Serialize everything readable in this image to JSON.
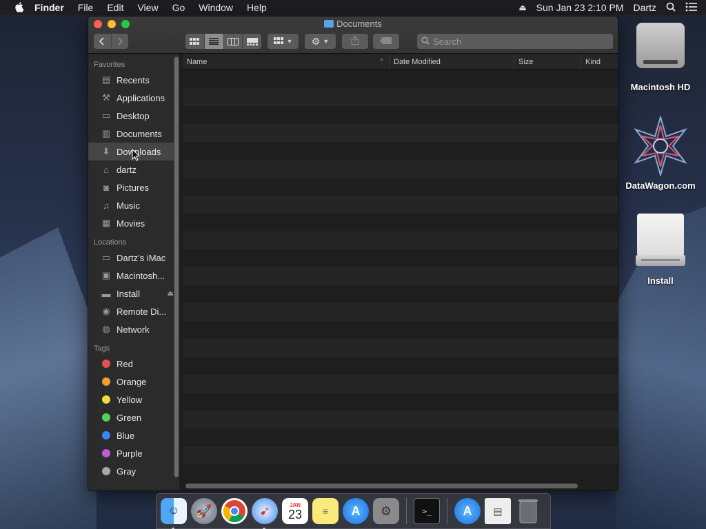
{
  "menubar": {
    "app": "Finder",
    "items": [
      "File",
      "Edit",
      "View",
      "Go",
      "Window",
      "Help"
    ],
    "datetime": "Sun Jan 23  2:10 PM",
    "user": "Dartz"
  },
  "window": {
    "title": "Documents",
    "search_placeholder": "Search"
  },
  "sidebar": {
    "favorites_heading": "Favorites",
    "favorites": [
      {
        "label": "Recents",
        "icon": "clock-icon"
      },
      {
        "label": "Applications",
        "icon": "applications-icon"
      },
      {
        "label": "Desktop",
        "icon": "desktop-icon"
      },
      {
        "label": "Documents",
        "icon": "document-icon"
      },
      {
        "label": "Downloads",
        "icon": "download-icon"
      },
      {
        "label": "dartz",
        "icon": "home-icon"
      },
      {
        "label": "Pictures",
        "icon": "camera-icon"
      },
      {
        "label": "Music",
        "icon": "music-icon"
      },
      {
        "label": "Movies",
        "icon": "film-icon"
      }
    ],
    "locations_heading": "Locations",
    "locations": [
      {
        "label": "Dartz’s iMac",
        "icon": "computer-icon"
      },
      {
        "label": "Macintosh...",
        "icon": "disk-icon"
      },
      {
        "label": "Install",
        "icon": "drive-icon"
      },
      {
        "label": "Remote Di...",
        "icon": "disc-icon"
      },
      {
        "label": "Network",
        "icon": "globe-icon"
      }
    ],
    "tags_heading": "Tags",
    "tags": [
      {
        "label": "Red",
        "color": "#e6504a"
      },
      {
        "label": "Orange",
        "color": "#f0a030"
      },
      {
        "label": "Yellow",
        "color": "#f2dc3a"
      },
      {
        "label": "Green",
        "color": "#4ed25a"
      },
      {
        "label": "Blue",
        "color": "#3b86f0"
      },
      {
        "label": "Purple",
        "color": "#c25ad6"
      },
      {
        "label": "Gray",
        "color": "#a8a8a8"
      }
    ]
  },
  "columns": {
    "name": "Name",
    "date": "Date Modified",
    "size": "Size",
    "kind": "Kind"
  },
  "desktop": {
    "icons": [
      {
        "label": "Macintosh HD"
      },
      {
        "label": "DataWagon.com"
      },
      {
        "label": "Install"
      }
    ]
  },
  "dock": {
    "calendar_month": "JAN",
    "calendar_day": "23"
  }
}
